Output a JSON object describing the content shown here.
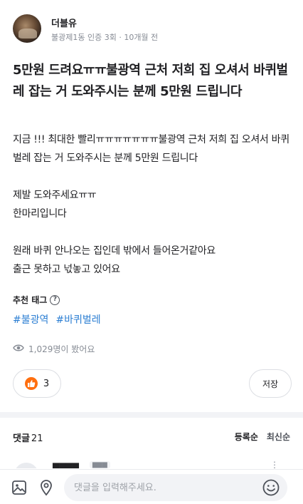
{
  "author": {
    "nickname": "더블유",
    "meta": "불광제1동 인증 3회 · 10개월 전"
  },
  "post": {
    "title": "5만원 드려요ㅠㅠ불광역 근처 저희 집 오셔서 바퀴벌레 잡는 거 도와주시는 분께 5만원 드립니다",
    "body": {
      "p1": "지금 !!! 최대한 빨리ㅠㅠㅠㅠㅠㅠㅠ불광역 근처 저희 집 오셔서 바퀴벌레 잡는 거 도와주시는 분께 5만원 드립니다",
      "p2a": "제발 도와주세요ㅠㅠ",
      "p2b": "한마리입니다",
      "p3a": "원래 바퀴 안나오는 집인데 밖에서 들어온거같아요",
      "p3b": "출근 못하고 넋놓고 있어요"
    }
  },
  "tags": {
    "label": "추천 태그",
    "help_glyph": "?",
    "items": [
      "#불광역",
      "#바퀴벌레"
    ]
  },
  "views": {
    "text": "1,029명이 봤어요"
  },
  "actions": {
    "like_count": "3",
    "save_label": "저장"
  },
  "comments": {
    "title": "댓글",
    "count": "21",
    "sort_options": [
      "등록순",
      "최신순"
    ]
  },
  "comment_bar": {
    "placeholder": "댓글을 입력해주세요."
  },
  "colors": {
    "accent": "#ff6f0f",
    "tag": "#2d7fd3",
    "muted": "#868b94"
  }
}
